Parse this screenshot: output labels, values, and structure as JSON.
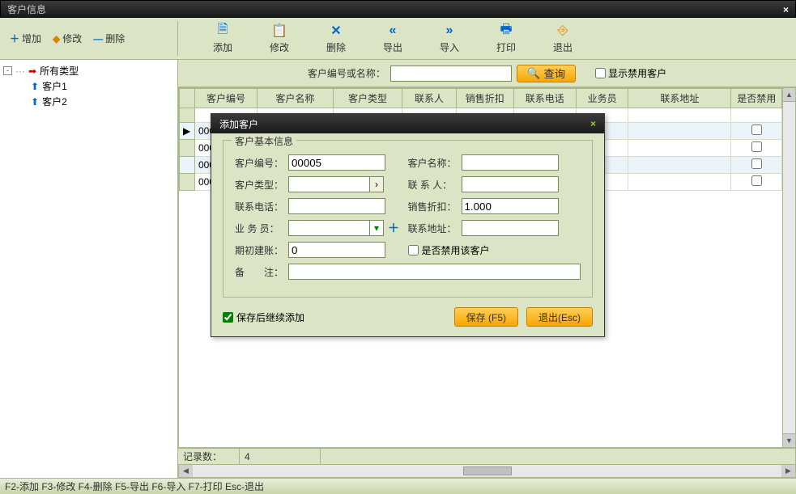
{
  "window": {
    "title": "客户信息"
  },
  "tree_tools": {
    "add": "增加",
    "edit": "修改",
    "delete": "删除"
  },
  "doc_tools": {
    "add": "添加",
    "edit": "修改",
    "delete": "删除",
    "export": "导出",
    "import": "导入",
    "print": "打印",
    "exit": "退出"
  },
  "tree": {
    "root": "所有类型",
    "children": [
      "客户1",
      "客户2"
    ]
  },
  "search": {
    "label": "客户编号或名称：",
    "value": "",
    "button": "查询",
    "show_disabled": "显示禁用客户"
  },
  "grid": {
    "columns": [
      "客户编号",
      "客户名称",
      "客户类型",
      "联系人",
      "销售折扣",
      "联系电话",
      "业务员",
      "联系地址",
      "是否禁用"
    ],
    "rows": [
      {
        "code": "000"
      },
      {
        "code": "000"
      },
      {
        "code": "000"
      },
      {
        "code": "000"
      }
    ]
  },
  "footer": {
    "record_label": "记录数：",
    "record_count": "4"
  },
  "statusbar": "F2-添加 F3-修改 F4-删除 F5-导出 F6-导入 F7-打印 Esc-退出",
  "dialog": {
    "title": "添加客户",
    "legend": "客户基本信息",
    "labels": {
      "code": "客户编号：",
      "name": "客户名称：",
      "type": "客户类型：",
      "contact": "联 系 人：",
      "phone": "联系电话：",
      "discount": "销售折扣：",
      "salesman": "业 务 员：",
      "address": "联系地址：",
      "opening": "期初建账：",
      "disable": "是否禁用该客户",
      "remark": "备　　注："
    },
    "values": {
      "code": "00005",
      "name": "",
      "type": "",
      "contact": "",
      "phone": "",
      "discount": "1.000",
      "salesman": "",
      "address": "",
      "opening": "0",
      "remark": ""
    },
    "continue_add": "保存后继续添加",
    "save_btn": "保存 (F5)",
    "exit_btn": "退出(Esc)"
  }
}
